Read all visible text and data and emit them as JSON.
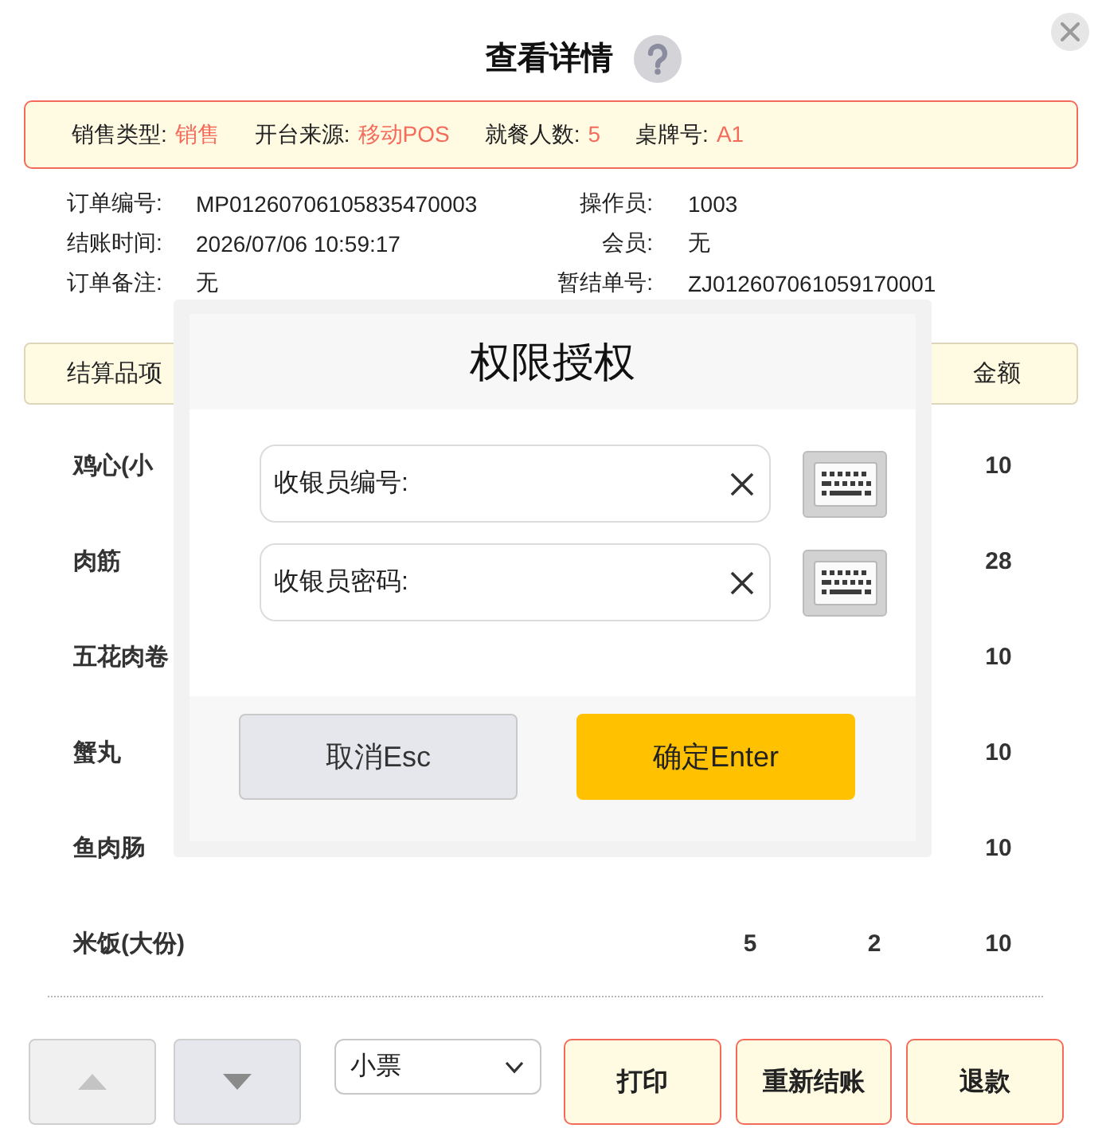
{
  "dialog": {
    "title": "查看详情"
  },
  "summary": [
    {
      "label": "销售类型:",
      "value": "销售"
    },
    {
      "label": "开台来源:",
      "value": "移动POS"
    },
    {
      "label": "就餐人数:",
      "value": "5"
    },
    {
      "label": "桌牌号:",
      "value": "A1"
    }
  ],
  "details": [
    {
      "label": "订单编号:",
      "value": "MP01260706105835470003"
    },
    {
      "label": "操作员:",
      "value": "1003"
    },
    {
      "label": "结账时间:",
      "value": "2026/07/06 10:59:17"
    },
    {
      "label": "会员:",
      "value": "无"
    },
    {
      "label": "订单备注:",
      "value": "无"
    },
    {
      "label": "暂结单号:",
      "value": "ZJ012607061059170001"
    }
  ],
  "table": {
    "header": {
      "item": "结算品项",
      "amount": "金额"
    },
    "rows": [
      {
        "item": "鸡心(小",
        "amount": "10"
      },
      {
        "item": "肉筋",
        "amount": "28"
      },
      {
        "item": "五花肉卷",
        "amount": "10"
      },
      {
        "item": "蟹丸",
        "amount": "10"
      },
      {
        "item": "鱼肉肠",
        "amount": "10"
      },
      {
        "item": "米饭(大份)",
        "column_2": "5",
        "column_3": "2",
        "amount": "10"
      }
    ]
  },
  "bottom_bar": {
    "scroll_buttons": [
      {
        "kind": "up",
        "disabled": true
      },
      {
        "kind": "down",
        "disabled": false
      }
    ],
    "print_type": {
      "value": "小票"
    },
    "actions": [
      {
        "label": "打印"
      },
      {
        "label": "重新结账"
      },
      {
        "label": "退款"
      }
    ]
  },
  "auth_dialog": {
    "title": "权限授权",
    "fields": [
      {
        "label": "收银员编号:"
      },
      {
        "label": "收银员密码:"
      }
    ],
    "buttons": [
      {
        "label": "取消Esc",
        "kind": "cancel"
      },
      {
        "label": "确定Enter",
        "kind": "confirm"
      }
    ]
  }
}
